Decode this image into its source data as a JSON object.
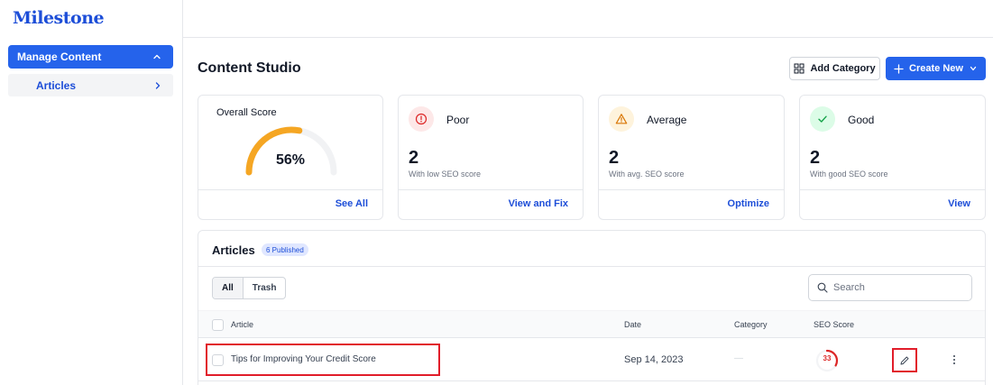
{
  "sidebar": {
    "logo": "Milestone",
    "parent_label": "Manage Content",
    "child_label": "Articles"
  },
  "header": {
    "title": "Content Studio",
    "add_category_label": "Add Category",
    "create_new_label": "Create New"
  },
  "overall": {
    "title": "Overall Score",
    "value_text": "56%",
    "value": 56,
    "link": "See All",
    "gauge_color": "#f5a623",
    "track_color": "#f1f2f4"
  },
  "cards": [
    {
      "label": "Poor",
      "count": "2",
      "sub": "With low SEO score",
      "link": "View and Fix",
      "icon": "info-circle-icon",
      "color": "#dc2626",
      "bg": "#fde8e8"
    },
    {
      "label": "Average",
      "count": "2",
      "sub": "With avg. SEO score",
      "link": "Optimize",
      "icon": "warning-triangle-icon",
      "color": "#d97706",
      "bg": "#fef3dc"
    },
    {
      "label": "Good",
      "count": "2",
      "sub": "With good SEO score",
      "link": "View",
      "icon": "check-icon",
      "color": "#16a34a",
      "bg": "#dcfce7"
    }
  ],
  "articles": {
    "title": "Articles",
    "badge": "6 Published",
    "tabs": [
      "All",
      "Trash"
    ],
    "search_placeholder": "Search",
    "columns": {
      "article": "Article",
      "date": "Date",
      "category": "Category",
      "seo": "SEO Score"
    },
    "rows": [
      {
        "title": "Tips for Improving Your Credit Score",
        "date": "Sep 14, 2023",
        "category": "—",
        "seo": "33",
        "seo_value": 33
      }
    ]
  }
}
